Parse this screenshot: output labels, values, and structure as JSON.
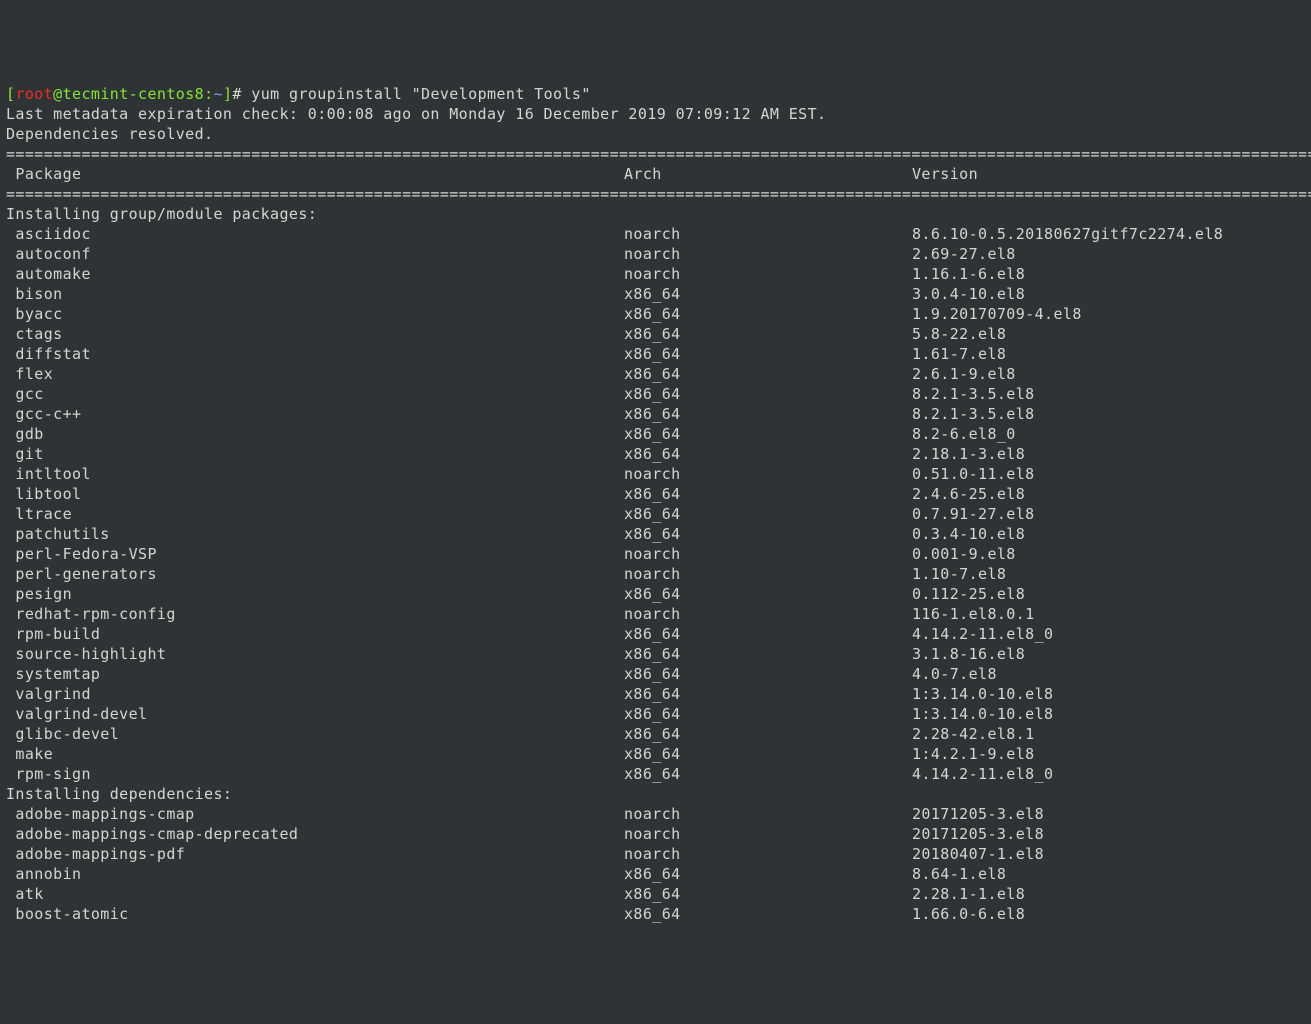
{
  "prompt": {
    "open_bracket": "[",
    "user": "root",
    "at": "@",
    "host": "tecmint-centos8",
    "colon": ":",
    "path": "~",
    "close_bracket": "]",
    "hash": "#",
    "command": " yum groupinstall \"Development Tools\""
  },
  "metadata_line": "Last metadata expiration check: 0:00:08 ago on Monday 16 December 2019 07:09:12 AM EST.",
  "resolved_line": "Dependencies resolved.",
  "divider": "=============================================================================================================================================",
  "header": {
    "package": " Package",
    "arch": "Arch",
    "version": "Version"
  },
  "section1_title": "Installing group/module packages:",
  "section2_title": "Installing dependencies:",
  "group_packages": [
    {
      "name": " asciidoc",
      "arch": "noarch",
      "version": "8.6.10-0.5.20180627gitf7c2274.el8"
    },
    {
      "name": " autoconf",
      "arch": "noarch",
      "version": "2.69-27.el8"
    },
    {
      "name": " automake",
      "arch": "noarch",
      "version": "1.16.1-6.el8"
    },
    {
      "name": " bison",
      "arch": "x86_64",
      "version": "3.0.4-10.el8"
    },
    {
      "name": " byacc",
      "arch": "x86_64",
      "version": "1.9.20170709-4.el8"
    },
    {
      "name": " ctags",
      "arch": "x86_64",
      "version": "5.8-22.el8"
    },
    {
      "name": " diffstat",
      "arch": "x86_64",
      "version": "1.61-7.el8"
    },
    {
      "name": " flex",
      "arch": "x86_64",
      "version": "2.6.1-9.el8"
    },
    {
      "name": " gcc",
      "arch": "x86_64",
      "version": "8.2.1-3.5.el8"
    },
    {
      "name": " gcc-c++",
      "arch": "x86_64",
      "version": "8.2.1-3.5.el8"
    },
    {
      "name": " gdb",
      "arch": "x86_64",
      "version": "8.2-6.el8_0"
    },
    {
      "name": " git",
      "arch": "x86_64",
      "version": "2.18.1-3.el8"
    },
    {
      "name": " intltool",
      "arch": "noarch",
      "version": "0.51.0-11.el8"
    },
    {
      "name": " libtool",
      "arch": "x86_64",
      "version": "2.4.6-25.el8"
    },
    {
      "name": " ltrace",
      "arch": "x86_64",
      "version": "0.7.91-27.el8"
    },
    {
      "name": " patchutils",
      "arch": "x86_64",
      "version": "0.3.4-10.el8"
    },
    {
      "name": " perl-Fedora-VSP",
      "arch": "noarch",
      "version": "0.001-9.el8"
    },
    {
      "name": " perl-generators",
      "arch": "noarch",
      "version": "1.10-7.el8"
    },
    {
      "name": " pesign",
      "arch": "x86_64",
      "version": "0.112-25.el8"
    },
    {
      "name": " redhat-rpm-config",
      "arch": "noarch",
      "version": "116-1.el8.0.1"
    },
    {
      "name": " rpm-build",
      "arch": "x86_64",
      "version": "4.14.2-11.el8_0"
    },
    {
      "name": " source-highlight",
      "arch": "x86_64",
      "version": "3.1.8-16.el8"
    },
    {
      "name": " systemtap",
      "arch": "x86_64",
      "version": "4.0-7.el8"
    },
    {
      "name": " valgrind",
      "arch": "x86_64",
      "version": "1:3.14.0-10.el8"
    },
    {
      "name": " valgrind-devel",
      "arch": "x86_64",
      "version": "1:3.14.0-10.el8"
    },
    {
      "name": " glibc-devel",
      "arch": "x86_64",
      "version": "2.28-42.el8.1"
    },
    {
      "name": " make",
      "arch": "x86_64",
      "version": "1:4.2.1-9.el8"
    },
    {
      "name": " rpm-sign",
      "arch": "x86_64",
      "version": "4.14.2-11.el8_0"
    }
  ],
  "dep_packages": [
    {
      "name": " adobe-mappings-cmap",
      "arch": "noarch",
      "version": "20171205-3.el8"
    },
    {
      "name": " adobe-mappings-cmap-deprecated",
      "arch": "noarch",
      "version": "20171205-3.el8"
    },
    {
      "name": " adobe-mappings-pdf",
      "arch": "noarch",
      "version": "20180407-1.el8"
    },
    {
      "name": " annobin",
      "arch": "x86_64",
      "version": "8.64-1.el8"
    },
    {
      "name": " atk",
      "arch": "x86_64",
      "version": "2.28.1-1.el8"
    },
    {
      "name": " boost-atomic",
      "arch": "x86_64",
      "version": "1.66.0-6.el8"
    }
  ]
}
